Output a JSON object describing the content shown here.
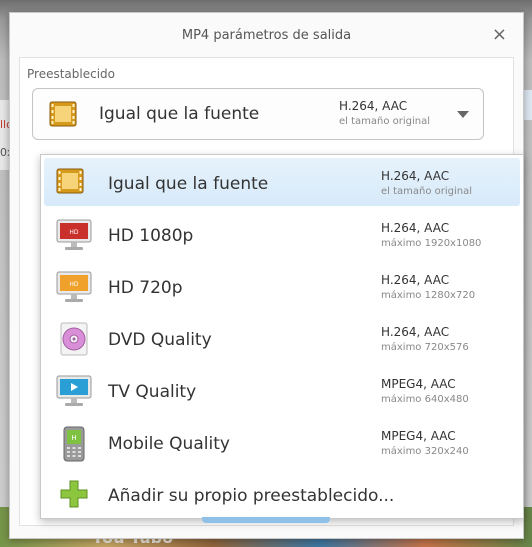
{
  "dialog": {
    "title": "MP4 parámetros de salida",
    "close_glyph": "×"
  },
  "preset": {
    "label": "Preestablecido",
    "selected": {
      "name": "Igual que la fuente",
      "codec": "H.264, AAC",
      "resolution": "el tamaño original",
      "icon": "film-icon"
    }
  },
  "dropdown": {
    "items": [
      {
        "name": "Igual que la fuente",
        "codec": "H.264, AAC",
        "resolution": "el tamaño original",
        "icon": "film-icon",
        "selected": true
      },
      {
        "name": "HD 1080p",
        "codec": "H.264, AAC",
        "resolution": "máximo 1920x1080",
        "icon": "monitor-hd-red-icon"
      },
      {
        "name": "HD 720p",
        "codec": "H.264, AAC",
        "resolution": "máximo 1280x720",
        "icon": "monitor-hd-orange-icon"
      },
      {
        "name": "DVD Quality",
        "codec": "H.264, AAC",
        "resolution": "máximo 720x576",
        "icon": "dvd-disc-icon"
      },
      {
        "name": "TV Quality",
        "codec": "MPEG4, AAC",
        "resolution": "máximo 640x480",
        "icon": "tv-play-icon"
      },
      {
        "name": "Mobile Quality",
        "codec": "MPEG4, AAC",
        "resolution": "máximo 320x240",
        "icon": "mobile-phone-icon"
      }
    ],
    "add_preset_label": "Añadir su propio preestablecido...",
    "add_icon": "plus-icon"
  },
  "background": {
    "youtube_text": "You Tubo",
    "left_glimpse": [
      "llo",
      "0x"
    ]
  }
}
